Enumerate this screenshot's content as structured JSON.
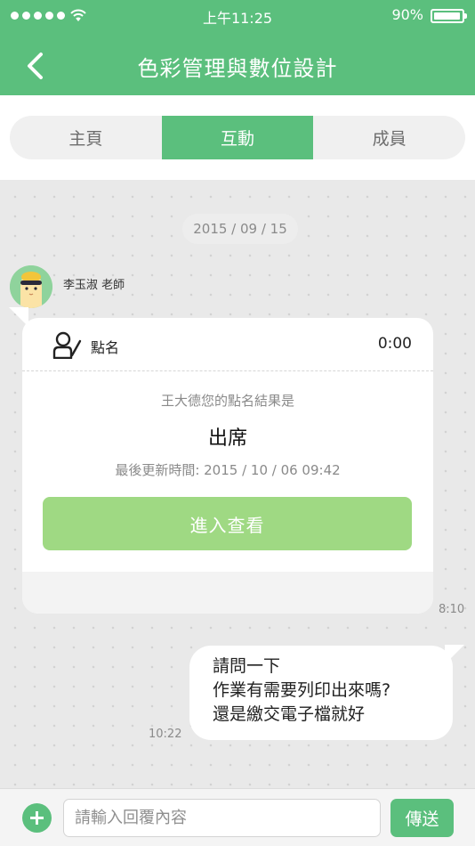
{
  "status_bar": {
    "time": "上午11:25",
    "battery_percent": "90%",
    "battery_level": 0.9,
    "signal_icon": "signal-dots-icon",
    "wifi_icon": "wifi-icon"
  },
  "header": {
    "title": "色彩管理與數位設計",
    "back_icon": "chevron-left-icon"
  },
  "tabs": [
    {
      "label": "主頁",
      "active": false
    },
    {
      "label": "互動",
      "active": true
    },
    {
      "label": "成員",
      "active": false
    }
  ],
  "chat": {
    "date": "2015 / 09 / 15",
    "incoming": {
      "sender": "李玉淑  老師",
      "time": "8:10",
      "card": {
        "icon": "rollcall-icon",
        "title": "點名",
        "timer": "0:00",
        "result_label": "王大德您的點名結果是",
        "result_value": "出席",
        "updated": "最後更新時間: 2015 / 10 / 06 09:42",
        "button_label": "進入查看"
      }
    },
    "outgoing": {
      "lines": [
        "請問一下",
        "作業有需要列印出來嗎?",
        "還是繳交電子檔就好"
      ],
      "time": "10:22"
    }
  },
  "composer": {
    "add_icon": "plus-circle-icon",
    "placeholder": "請輸入回覆內容",
    "value": "",
    "send_label": "傳送"
  },
  "colors": {
    "brand_green": "#5bbf7d",
    "button_light_green": "#9fd983",
    "chat_background": "#e9e9e9"
  }
}
